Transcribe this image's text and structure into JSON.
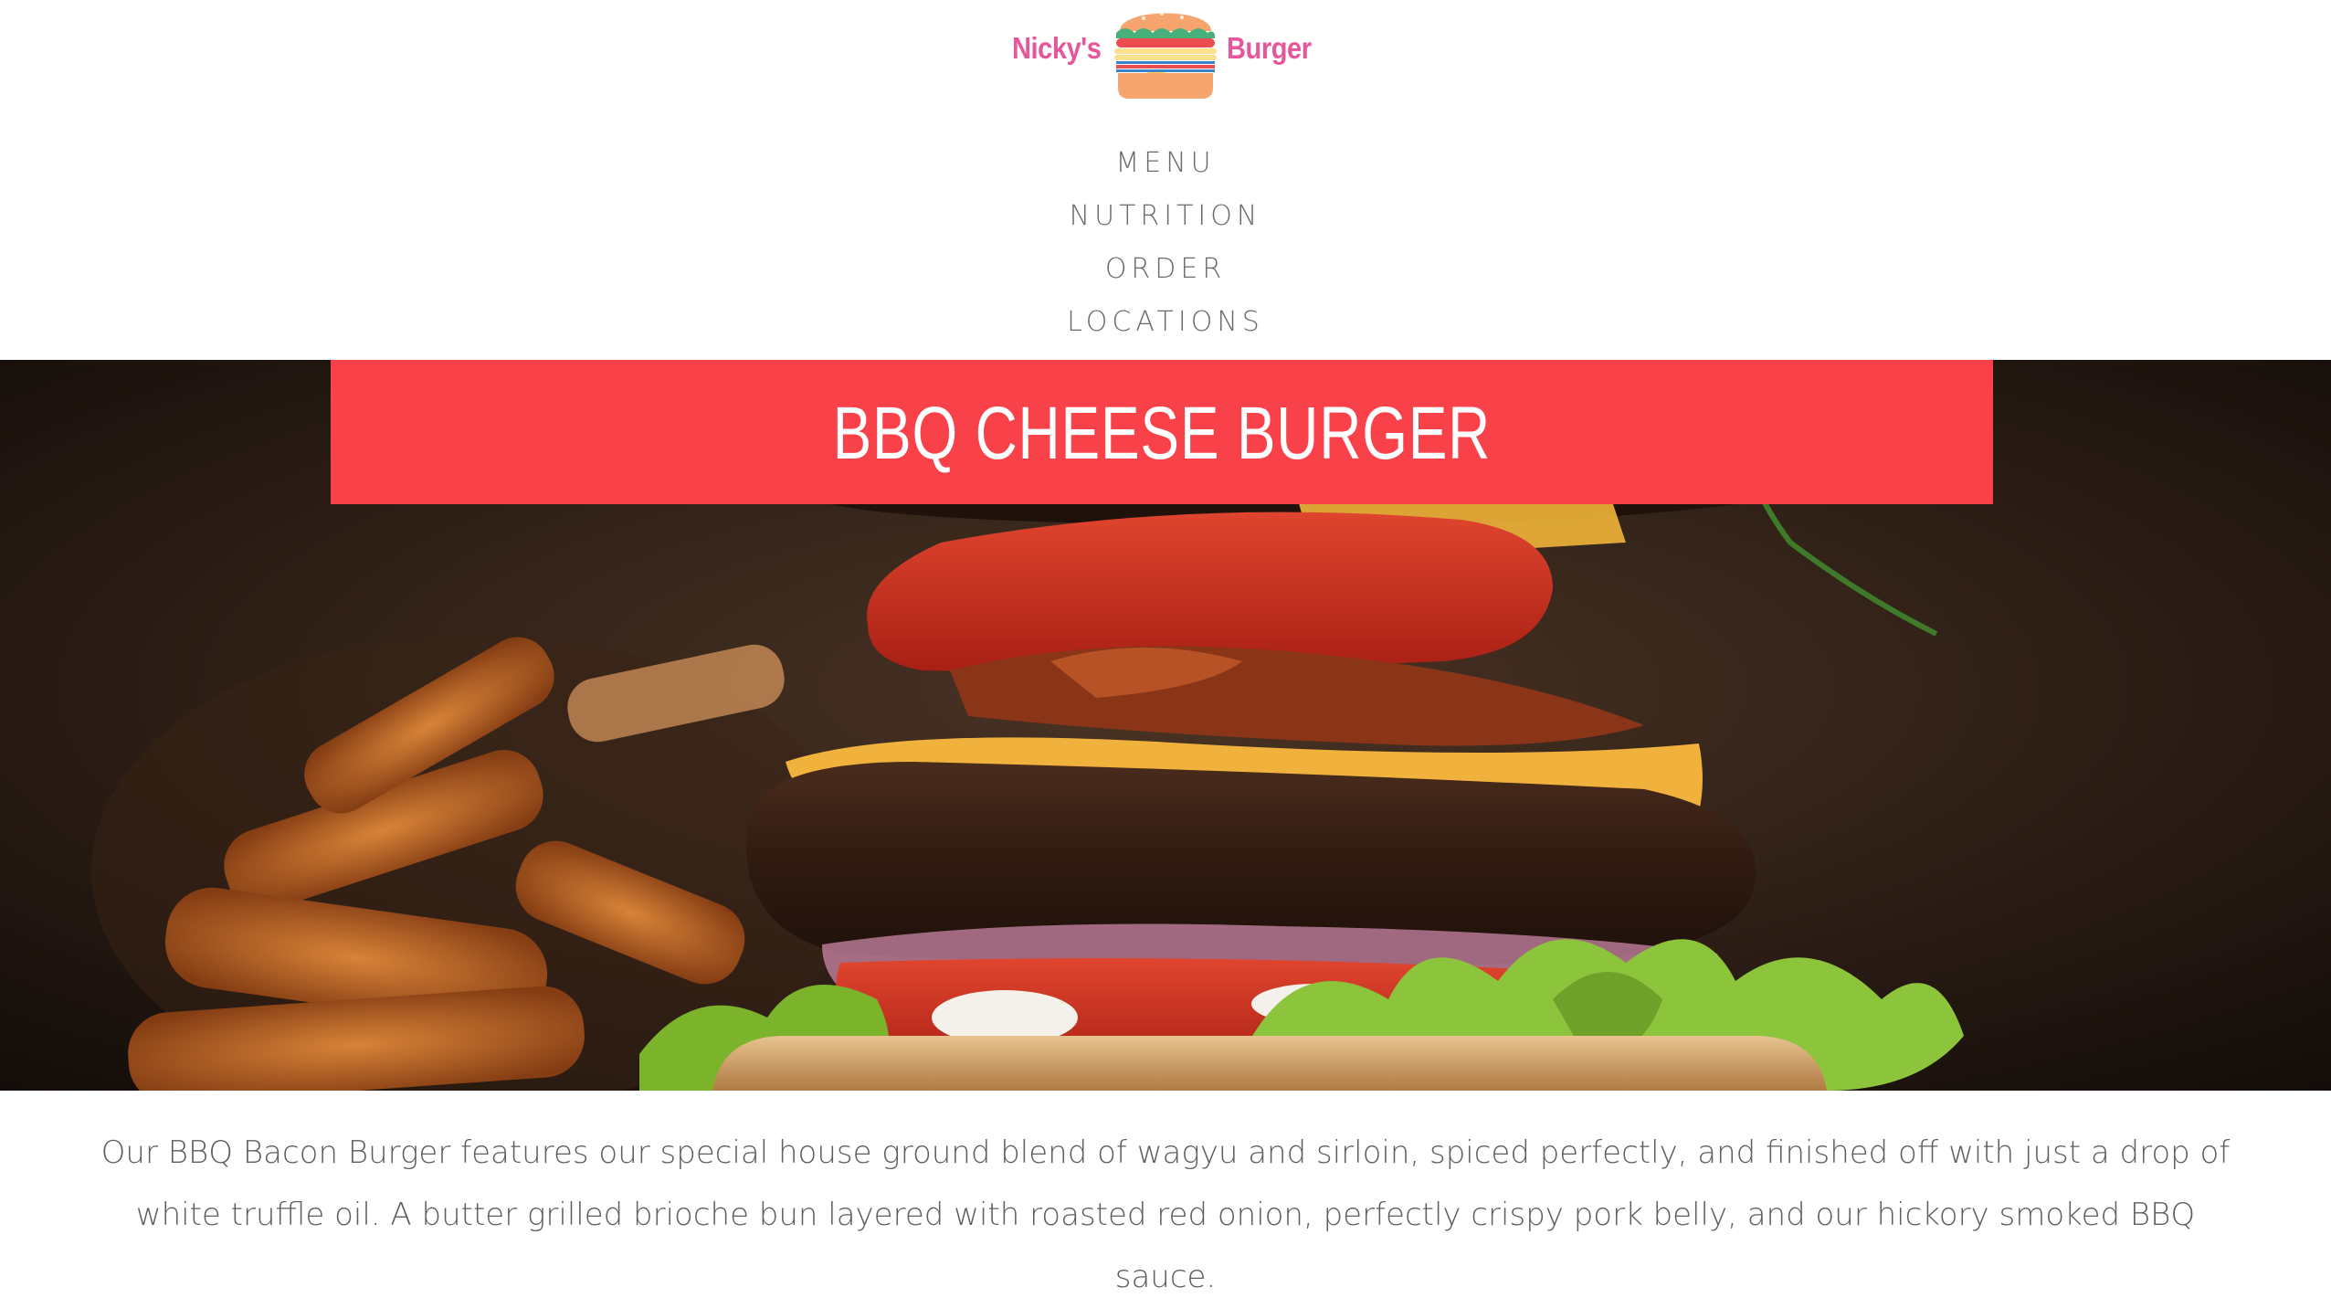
{
  "logo": {
    "left_text": "Nicky's",
    "right_text": "Burger",
    "icon": "burger-icon"
  },
  "nav": {
    "items": [
      {
        "label": "MENU"
      },
      {
        "label": "NUTRITION"
      },
      {
        "label": "ORDER"
      },
      {
        "label": "LOCATIONS"
      }
    ]
  },
  "hero": {
    "title": "BBQ CHEESE BURGER"
  },
  "description": {
    "text": "Our BBQ Bacon Burger features our special house ground blend of wagyu and sirloin, spiced perfectly, and finished off with just a drop of white truffle oil. A butter grilled brioche bun layered with roasted red onion, perfectly crispy pork belly, and our hickory smoked BBQ sauce."
  },
  "colors": {
    "accent": "#f84149",
    "logo_pink": "#e5569b",
    "nav_text": "#6b6b6b"
  }
}
